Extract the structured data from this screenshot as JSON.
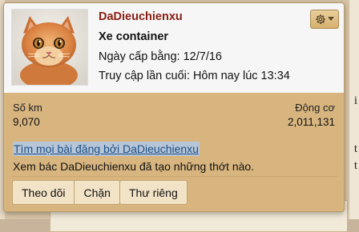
{
  "user": {
    "username": "DaDieuchienxu",
    "title": "Xe container",
    "join_label": "Ngày cấp bằng:",
    "join_date": "12/7/16",
    "last_seen_label": "Truy cập lần cuối:",
    "last_seen_value": "Hôm nay lúc 13:34"
  },
  "stats": {
    "km_label": "Số km",
    "km_value": "9,070",
    "engine_label": "Động cơ",
    "engine_value": "2,011,131"
  },
  "links": {
    "find_posts": "Tìm mọi bài đăng bởi DaDieuchienxu",
    "see_threads": "Xem bác DaDieuchienxu đã tạo những thớt nào."
  },
  "actions": {
    "follow": "Theo dõi",
    "block": "Chặn",
    "message": "Thư riêng"
  },
  "background": {
    "side_chars": [
      "i",
      "t",
      "t"
    ]
  },
  "icons": {
    "settings": "gear-icon",
    "dropdown": "chevron-down-icon",
    "avatar": "cat-photo"
  }
}
